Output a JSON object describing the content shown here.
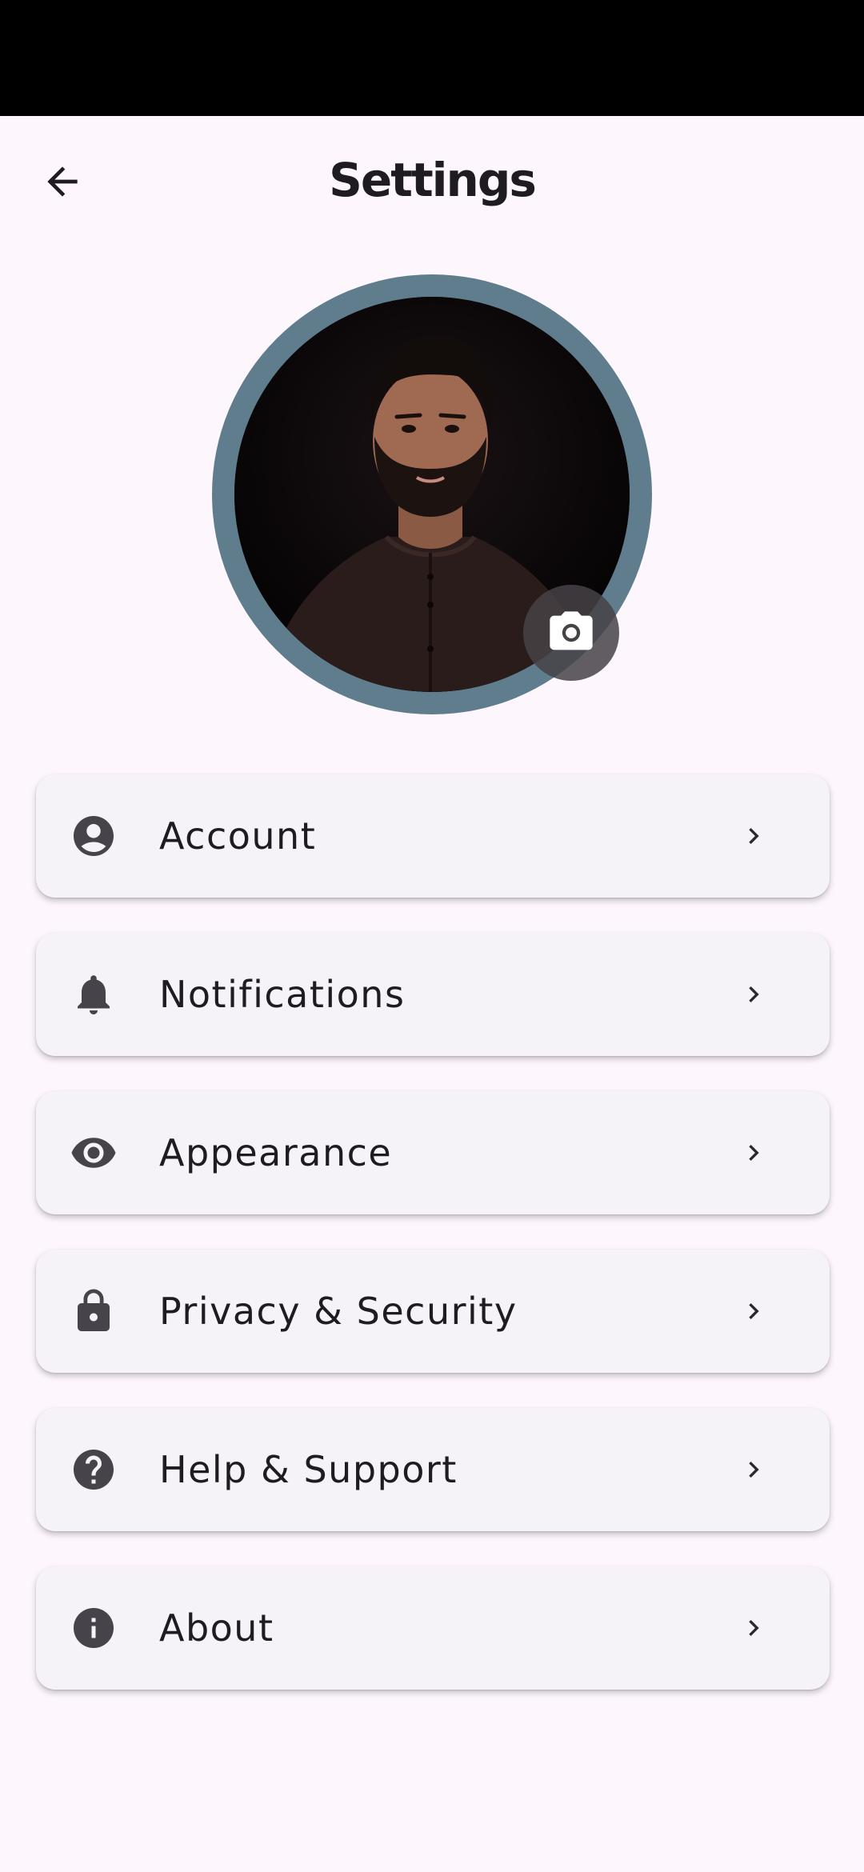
{
  "app_bar": {
    "title": "Settings",
    "back_icon": "arrow-back-icon"
  },
  "profile": {
    "camera_icon": "camera-icon",
    "ring_color": "#5f7d8c"
  },
  "menu": {
    "items": [
      {
        "label": "Account",
        "icon": "account-circle-icon"
      },
      {
        "label": "Notifications",
        "icon": "bell-icon"
      },
      {
        "label": "Appearance",
        "icon": "eye-icon"
      },
      {
        "label": "Privacy & Security",
        "icon": "lock-icon"
      },
      {
        "label": "Help & Support",
        "icon": "help-icon"
      },
      {
        "label": "About",
        "icon": "info-icon"
      }
    ]
  },
  "colors": {
    "background": "#fdf7fd",
    "card": "#f5f2f8",
    "icon": "#46444a",
    "text": "#1e1c22"
  }
}
